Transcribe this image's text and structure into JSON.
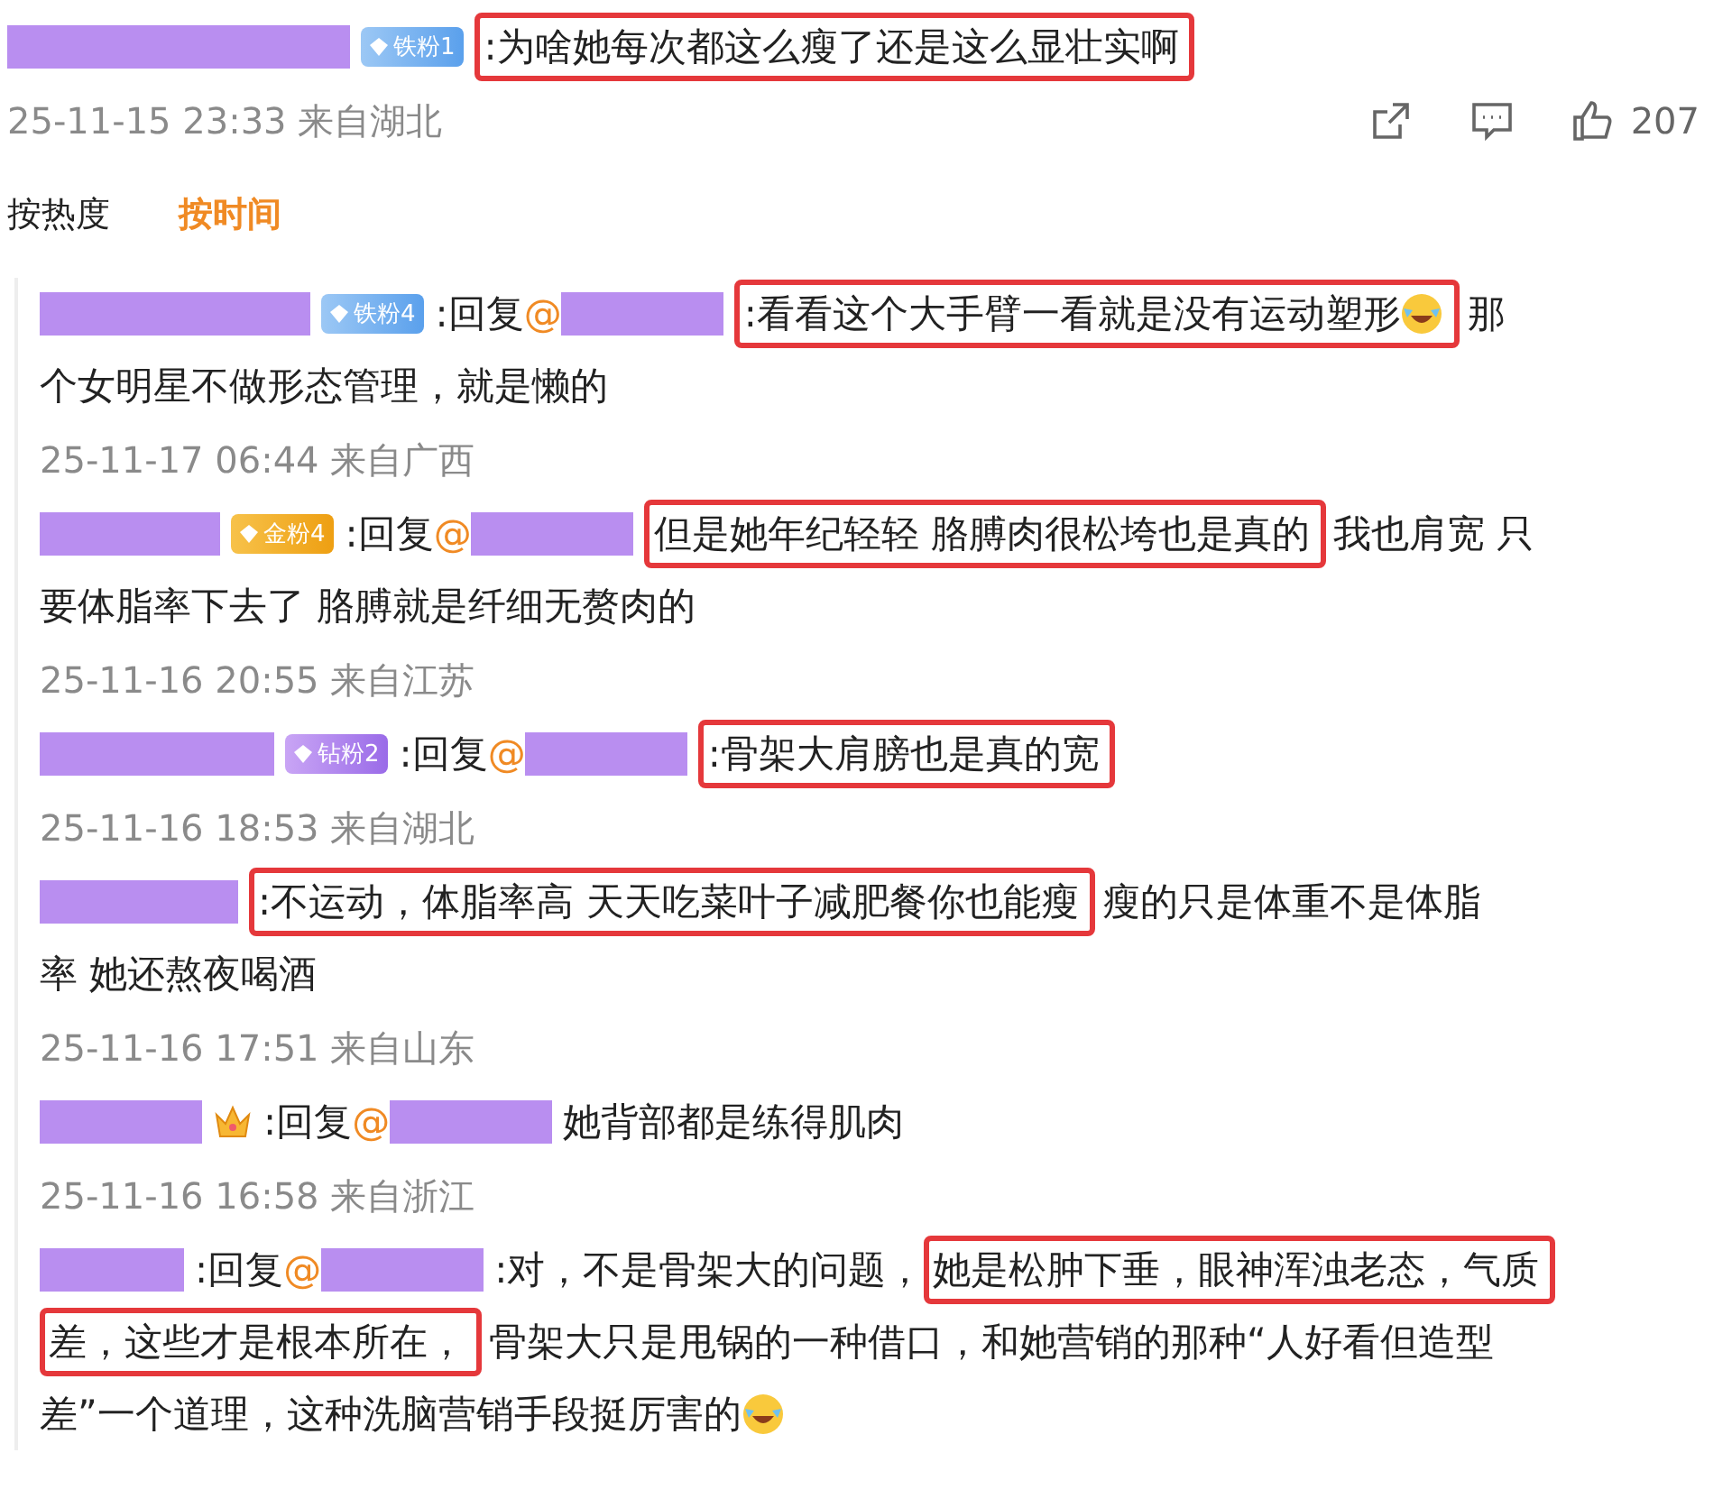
{
  "comment": {
    "badge": {
      "kind": "iron",
      "label": "铁粉1"
    },
    "lines": [
      [
        {
          "text": ":为啥她每次都这么瘦了还是这么显壮实啊",
          "highlighted": true,
          "emoji": false
        }
      ]
    ],
    "meta": "25-11-15 23:33 来自湖北",
    "likes": "207"
  },
  "sort_tabs": [
    {
      "label": "按热度",
      "selected": false
    },
    {
      "label": "按时间",
      "selected": true
    }
  ],
  "replies": [
    {
      "badge": {
        "kind": "iron",
        "label": "铁粉4"
      },
      "reply_label": ":回复",
      "at": "@",
      "lines": [
        [
          {
            "text": ":看看这个大手臂一看就是没有运动塑形",
            "highlighted": true,
            "emoji": true
          },
          {
            "text": "那",
            "highlighted": false,
            "emoji": false
          }
        ],
        [
          {
            "text": "个女明星不做形态管理，就是懒的",
            "highlighted": false,
            "emoji": false
          }
        ]
      ],
      "meta": "25-11-17 06:44 来自广西"
    },
    {
      "badge": {
        "kind": "gold",
        "label": "金粉4"
      },
      "reply_label": ":回复",
      "at": "@",
      "lines": [
        [
          {
            "text": "但是她年纪轻轻 胳膊肉很松垮也是真的",
            "highlighted": true,
            "emoji": false
          },
          {
            "text": "我也肩宽 只",
            "highlighted": false,
            "emoji": false
          }
        ],
        [
          {
            "text": "要体脂率下去了 胳膊就是纤细无赘肉的",
            "highlighted": false,
            "emoji": false
          }
        ]
      ],
      "meta": "25-11-16 20:55 来自江苏"
    },
    {
      "badge": {
        "kind": "diamond",
        "label": "钻粉2"
      },
      "reply_label": ":回复",
      "at": "@",
      "lines": [
        [
          {
            "text": ":骨架大肩膀也是真的宽",
            "highlighted": true,
            "emoji": false
          }
        ]
      ],
      "meta": "25-11-16 18:53 来自湖北"
    },
    {
      "lines": [
        [
          {
            "text": ":不运动，体脂率高 天天吃菜叶子减肥餐你也能瘦",
            "highlighted": true,
            "emoji": false
          },
          {
            "text": "瘦的只是体重不是体脂",
            "highlighted": false,
            "emoji": false
          }
        ],
        [
          {
            "text": "率 她还熬夜喝酒",
            "highlighted": false,
            "emoji": false
          }
        ]
      ],
      "meta": "25-11-16 17:51 来自山东"
    },
    {
      "badge": {
        "kind": "crown"
      },
      "reply_label": ":回复",
      "at": "@",
      "lines": [
        [
          {
            "text": "她背部都是练得肌肉",
            "highlighted": false,
            "emoji": false
          }
        ]
      ],
      "meta": "25-11-16 16:58 来自浙江"
    },
    {
      "reply_label": ":回复",
      "at": "@",
      "lines": [
        [
          {
            "text": ":对，不是骨架大的问题，",
            "highlighted": false,
            "emoji": false
          },
          {
            "text": "她是松肿下垂，眼神浑浊老态，气质",
            "highlighted": true,
            "emoji": false
          }
        ],
        [
          {
            "text": "差，这些才是根本所在，",
            "highlighted": true,
            "emoji": false
          },
          {
            "text": "骨架大只是甩锅的一种借口，和她营销的那种“人好看但造型",
            "highlighted": false,
            "emoji": false
          }
        ],
        [
          {
            "text": "差”一个道理，这种洗脑营销手段挺厉害的",
            "highlighted": false,
            "emoji": true
          }
        ]
      ]
    }
  ]
}
